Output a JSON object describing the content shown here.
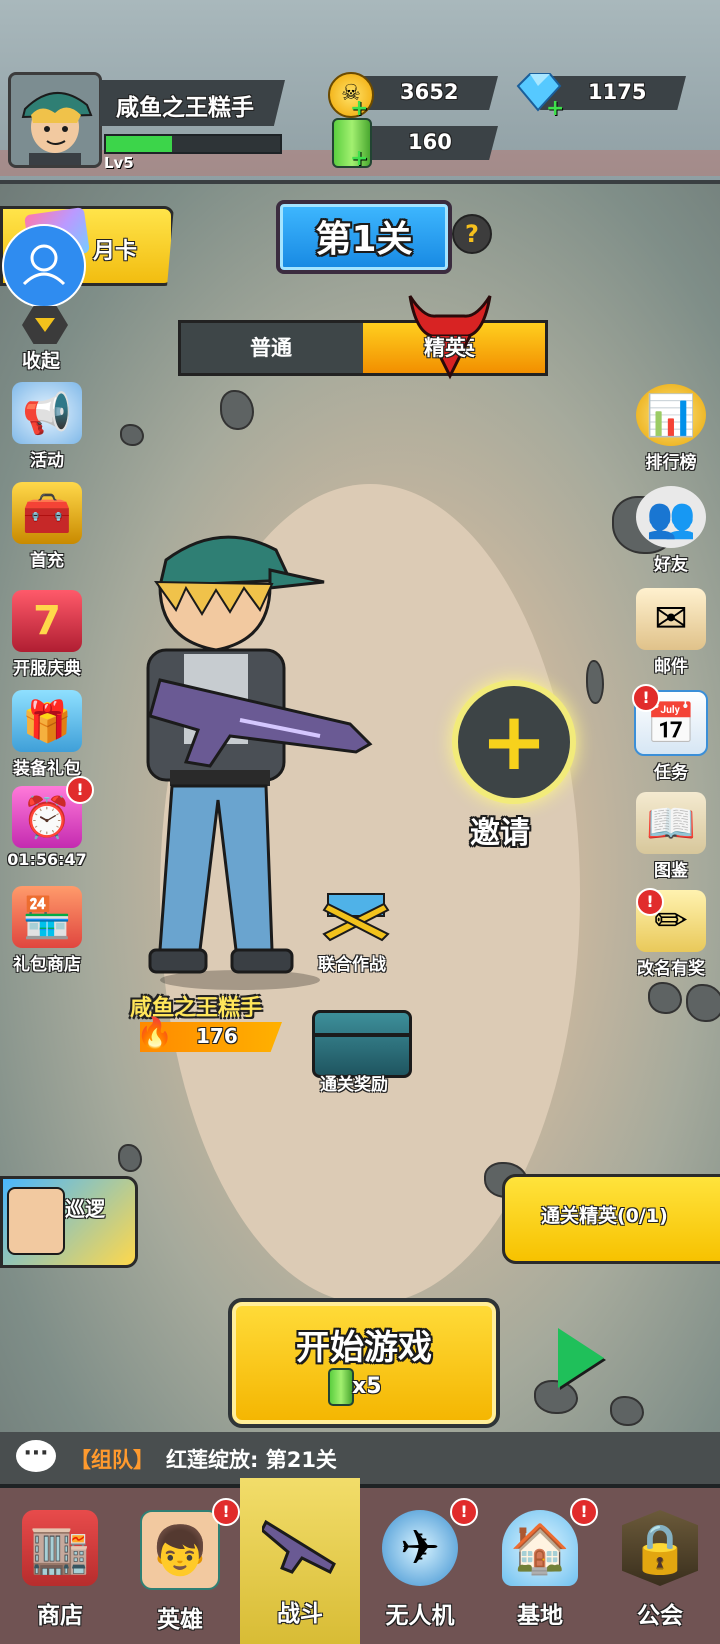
{
  "player": {
    "name": "咸鱼之王糕手",
    "level": "Lv5",
    "xp_fraction": 0.38
  },
  "resources": {
    "gold": "3652",
    "gems": "1175",
    "energy": "160"
  },
  "stage": {
    "title": "第1关",
    "help": "?"
  },
  "difficulty": {
    "normal": "普通",
    "elite": "精英",
    "selected": "精英"
  },
  "left_menu": {
    "month_card": "月卡",
    "collapse": "收起",
    "items": [
      {
        "label": "活动",
        "icon": "megaphone-icon"
      },
      {
        "label": "首充",
        "icon": "treasure-chest-icon"
      },
      {
        "label": "开服庆典",
        "icon": "red-chest-icon"
      },
      {
        "label": "装备礼包",
        "icon": "gift-icon"
      },
      {
        "label": "01:56:47",
        "icon": "timer-gift-icon"
      },
      {
        "label": "礼包商店",
        "icon": "shop-gift-icon"
      }
    ],
    "timer_badge": "!"
  },
  "right_menu": {
    "items": [
      {
        "label": "排行榜",
        "icon": "trophy-icon"
      },
      {
        "label": "好友",
        "icon": "friends-icon"
      },
      {
        "label": "邮件",
        "icon": "mail-icon"
      },
      {
        "label": "任务",
        "icon": "calendar-icon"
      },
      {
        "label": "图鉴",
        "icon": "book-icon"
      },
      {
        "label": "改名有奖",
        "icon": "pencil-icon"
      }
    ],
    "badge": "!"
  },
  "invite": {
    "label": "邀请",
    "symbol": "+"
  },
  "hero": {
    "name": "咸鱼之王糕手",
    "power": "176"
  },
  "map_actions": {
    "coop": "联合作战",
    "clear_reward": "通关奖励"
  },
  "patrol": {
    "label": "巡逻"
  },
  "elite_clear": {
    "label": "通关精英(0/1)"
  },
  "start": {
    "label": "开始游戏",
    "cost": "x5"
  },
  "chat": {
    "tag": "【组队】",
    "message": "红莲绽放: 第21关"
  },
  "bottom_nav": [
    {
      "label": "商店",
      "icon": "store-icon",
      "badge": ""
    },
    {
      "label": "英雄",
      "icon": "hero-icon",
      "badge": "!"
    },
    {
      "label": "战斗",
      "icon": "rifle-icon",
      "badge": "",
      "active": true
    },
    {
      "label": "无人机",
      "icon": "drone-icon",
      "badge": "!"
    },
    {
      "label": "基地",
      "icon": "base-dome-icon",
      "badge": "!"
    },
    {
      "label": "公会",
      "icon": "lock-icon",
      "badge": ""
    }
  ]
}
